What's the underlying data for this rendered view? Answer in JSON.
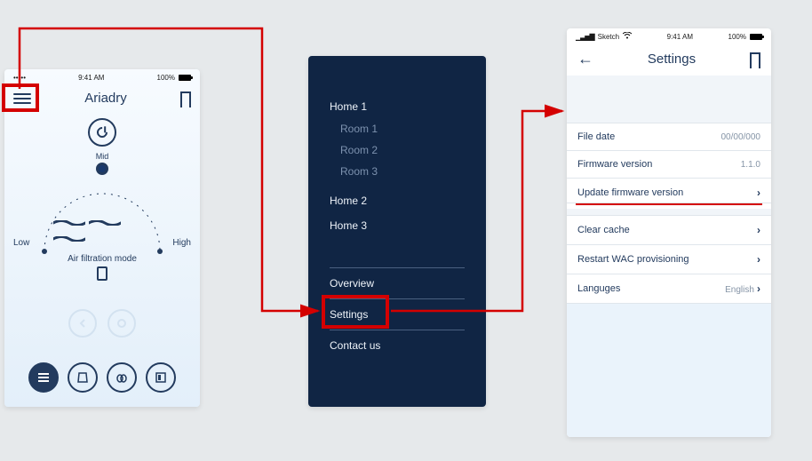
{
  "status": {
    "carrier": "Sketch",
    "time": "9:41 AM",
    "battery": "100%"
  },
  "phone1": {
    "title": "Ariadry",
    "selected_label": "Mid",
    "low": "Low",
    "high": "High",
    "mode_label": "Air filtration mode"
  },
  "phone2": {
    "home1": "Home 1",
    "rooms": [
      "Room 1",
      "Room 2",
      "Room 3"
    ],
    "home2": "Home 2",
    "home3": "Home 3",
    "overview": "Overview",
    "settings": "Settings",
    "contact": "Contact us"
  },
  "phone3": {
    "title": "Settings",
    "rows": {
      "file_date_label": "File date",
      "file_date_value": "00/00/000",
      "fw_label": "Firmware version",
      "fw_value": "1.1.0",
      "update_label": "Update firmware version",
      "clear_label": "Clear cache",
      "restart_label": "Restart WAC provisioning",
      "lang_label": "Languges",
      "lang_value": "English"
    }
  }
}
